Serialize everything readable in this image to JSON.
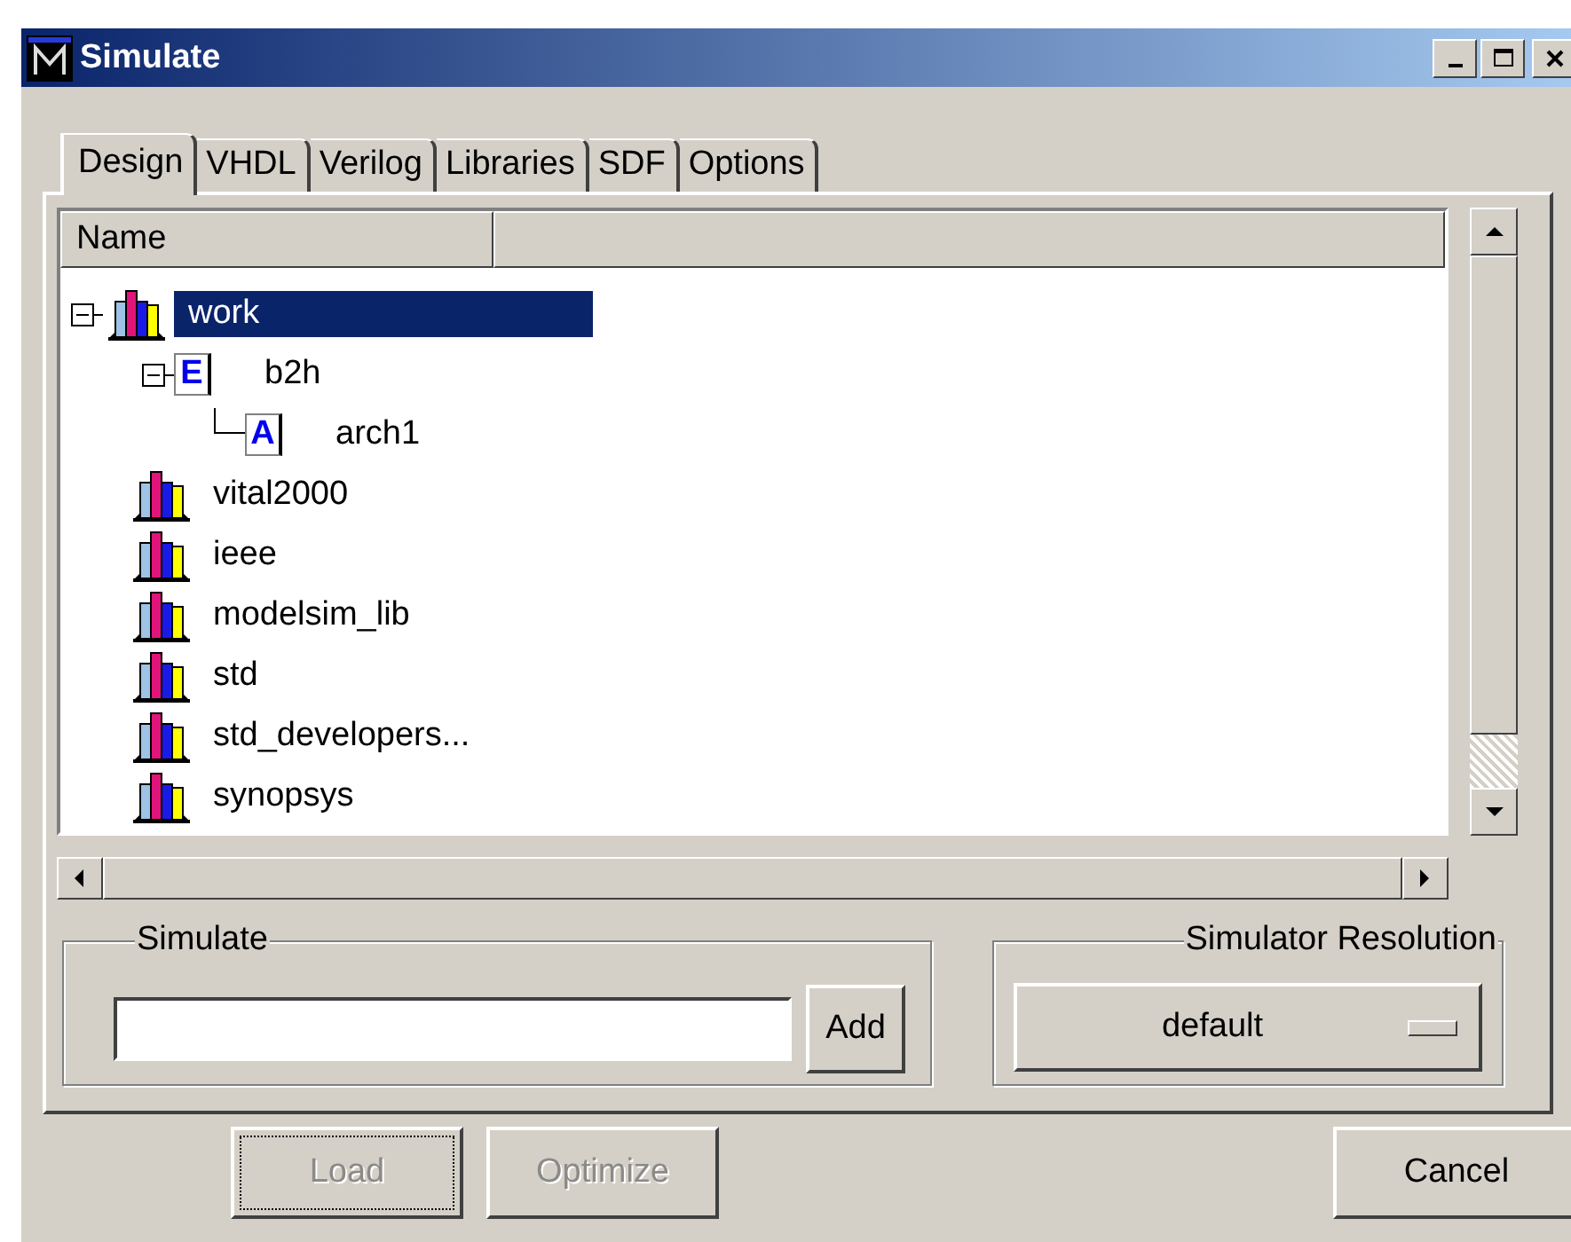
{
  "window": {
    "title": "Simulate"
  },
  "tabs": [
    {
      "label": "Design",
      "selected": true
    },
    {
      "label": "VHDL",
      "selected": false
    },
    {
      "label": "Verilog",
      "selected": false
    },
    {
      "label": "Libraries",
      "selected": false
    },
    {
      "label": "SDF",
      "selected": false
    },
    {
      "label": "Options",
      "selected": false
    }
  ],
  "tree": {
    "columns": [
      "Name"
    ],
    "items": [
      {
        "label": "work",
        "kind": "library",
        "selected": true,
        "expanded": true,
        "children": [
          {
            "label": "b2h",
            "kind": "entity",
            "icon_letter": "E",
            "selected": false,
            "expanded": true,
            "children": [
              {
                "label": "arch1",
                "kind": "architecture",
                "icon_letter": "A",
                "selected": false
              }
            ]
          }
        ]
      },
      {
        "label": "vital2000",
        "kind": "library",
        "selected": false
      },
      {
        "label": "ieee",
        "kind": "library",
        "selected": false
      },
      {
        "label": "modelsim_lib",
        "kind": "library",
        "selected": false
      },
      {
        "label": "std",
        "kind": "library",
        "selected": false
      },
      {
        "label": "std_developers...",
        "kind": "library",
        "selected": false
      },
      {
        "label": "synopsys",
        "kind": "library",
        "selected": false
      }
    ]
  },
  "simulate_group": {
    "title": "Simulate",
    "add_button": "Add"
  },
  "resolution_group": {
    "title": "Simulator Resolution",
    "value": "default"
  },
  "buttons": [
    {
      "label": "Load",
      "disabled": true,
      "focused": true
    },
    {
      "label": "Optimize",
      "disabled": true,
      "focused": false
    },
    {
      "label": "Cancel",
      "disabled": false,
      "focused": false
    }
  ]
}
